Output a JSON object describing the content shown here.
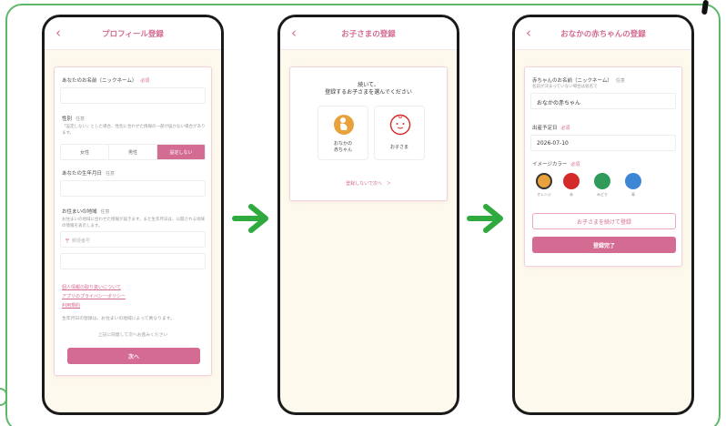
{
  "screens": [
    {
      "title": "プロフィール登録",
      "fields": [
        {
          "label": "あなたのお名前（ニックネーム）",
          "required": "必須"
        },
        {
          "label": "性別",
          "required": "任意",
          "hint": "「設定しない」とした場合、性別に合わせた情報の一部が届かない場合があります。"
        },
        {
          "label": "あなたの生年月日",
          "required": "任意"
        },
        {
          "label": "お住まいの地域",
          "required": "任意",
          "hint": "お住まいの地域に合わせた情報が届きます。また生年月日は、公開される地域の情報を表示します。"
        }
      ],
      "gender_options": [
        "女性",
        "男性",
        "設定しない"
      ],
      "postal_placeholder": "郵便番号",
      "links": [
        "個人情報の取り扱いについて",
        "アプリのプライバシーポリシー",
        "利用規約"
      ],
      "note1": "生年月日の登録は、お住まいの地域によって異なります。",
      "note2": "上記に同意して次へお進みください",
      "next_label": "次へ"
    },
    {
      "title": "お子さまの登録",
      "intro_line1": "続いて、",
      "intro_line2": "登録するお子さまを選んでください",
      "choice1_line1": "おなかの",
      "choice1_line2": "赤ちゃん",
      "choice2_label": "お子さま",
      "skip_link": "登録しないで次へ　＞"
    },
    {
      "title": "おなかの赤ちゃんの登録",
      "name_label": "赤ちゃんのお名前（ニックネーム）",
      "name_required": "任意",
      "name_hint": "名前が決まっていない場合は仮名で",
      "name_value": "おなかの赤ちゃん",
      "due_label": "出産予定日",
      "due_required": "必須",
      "due_value": "2026-07-10",
      "color_label": "イメージカラー",
      "color_required": "必須",
      "colors": [
        {
          "hex": "#e9a23b",
          "name": "オレンジ",
          "selected": true
        },
        {
          "hex": "#d42a2a",
          "name": "赤"
        },
        {
          "hex": "#2f9a5a",
          "name": "みどり"
        },
        {
          "hex": "#3d86d6",
          "name": "青"
        }
      ],
      "add_child_label": "お子さまを続けて登録",
      "complete_label": "登録完了"
    }
  ],
  "colors": {
    "accent": "#d46b93",
    "frame": "#5fb86a",
    "arrow": "#2eaa3e",
    "screen_bg": "#fdf9ec"
  }
}
